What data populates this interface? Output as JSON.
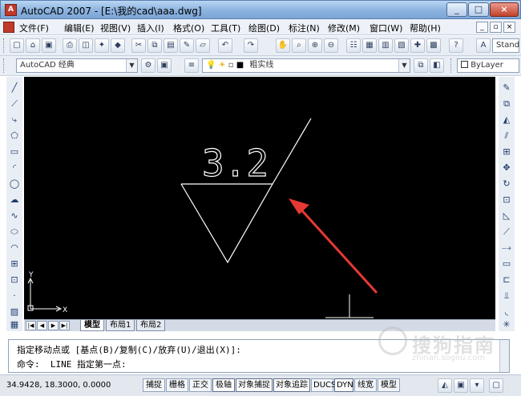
{
  "window": {
    "title": "AutoCAD 2007 - [E:\\我的cad\\aaa.dwg]",
    "minimize": "_",
    "maximize": "□",
    "close": "×"
  },
  "menu": {
    "items": [
      "文件(F)",
      "编辑(E)",
      "视图(V)",
      "插入(I)",
      "格式(O)",
      "工具(T)",
      "绘图(D)",
      "标注(N)",
      "修改(M)",
      "窗口(W)",
      "帮助(H)"
    ],
    "mdi_min": "_",
    "mdi_restore": "▫",
    "mdi_close": "×"
  },
  "toolbar": {
    "style_combo": "Stand",
    "workspace": "AutoCAD 经典",
    "layer": "粗实线",
    "bylayer": "ByLayer"
  },
  "canvas": {
    "annotation_value": "3.2",
    "ucs_x": "X",
    "ucs_y": "Y",
    "background": "#000000",
    "line_color": "#ffffff",
    "arrow_color": "#e53935"
  },
  "tabs": {
    "model": "模型",
    "layout1": "布局1",
    "layout2": "布局2"
  },
  "command": {
    "line1": "指定移动点或 [基点(B)/复制(C)/放弃(U)/退出(X)]:",
    "line2": "命令:  LINE 指定第一点:"
  },
  "status": {
    "coords": "34.9428, 18.3000, 0.0000",
    "buttons": [
      "捕捉",
      "栅格",
      "正交",
      "极轴",
      "对象捕捉",
      "对象追踪",
      "DUCS",
      "DYN",
      "线宽",
      "模型"
    ]
  },
  "watermark": {
    "text": "搜狗指南",
    "sub": "zhinan.sogou.com"
  }
}
